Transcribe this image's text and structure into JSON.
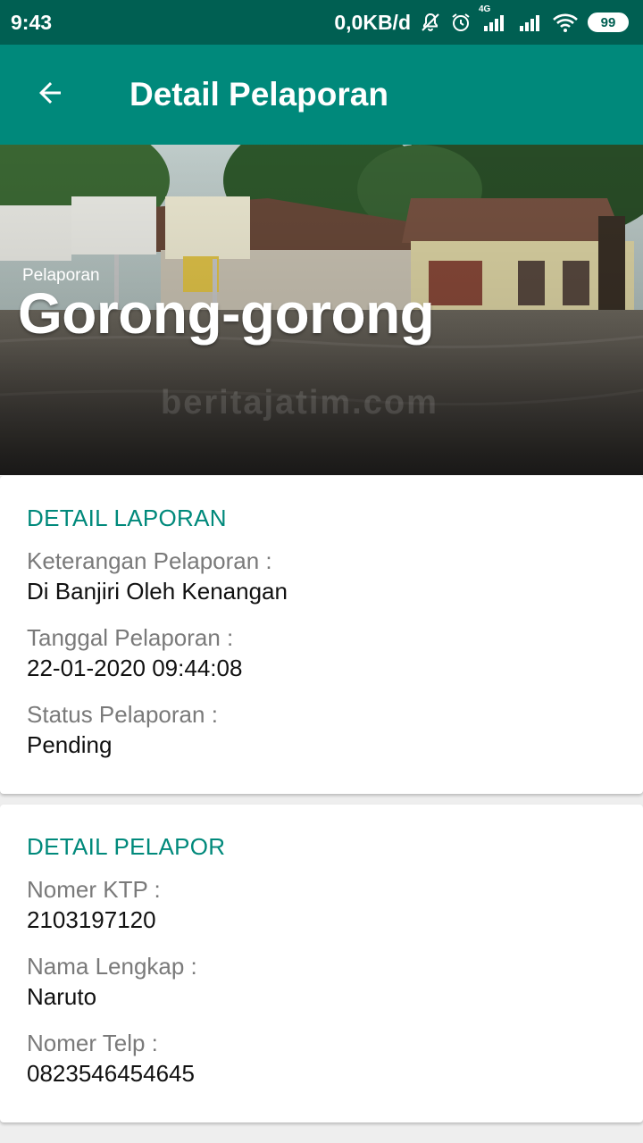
{
  "status_bar": {
    "time": "9:43",
    "data_speed": "0,0KB/d",
    "network_type": "4G",
    "battery": "99",
    "icons": [
      "mute-bell-icon",
      "alarm-icon",
      "signal-icon",
      "signal-icon",
      "wifi-icon",
      "battery-icon"
    ]
  },
  "app_bar": {
    "title": "Detail Pelaporan",
    "back_icon": "arrow-back-icon",
    "color": "#00897b"
  },
  "hero": {
    "overline": "Pelaporan",
    "title": "Gorong-gorong",
    "watermark": "beritajatim.com"
  },
  "report_details": {
    "section_title": "DETAIL LAPORAN",
    "fields": [
      {
        "label": "Keterangan Pelaporan :",
        "value": "Di Banjiri Oleh Kenangan"
      },
      {
        "label": "Tanggal Pelaporan :",
        "value": "22-01-2020 09:44:08"
      },
      {
        "label": "Status Pelaporan :",
        "value": "Pending"
      }
    ]
  },
  "reporter_details": {
    "section_title": "DETAIL PELAPOR",
    "fields": [
      {
        "label": "Nomer KTP :",
        "value": "2103197120"
      },
      {
        "label": "Nama Lengkap :",
        "value": "Naruto"
      },
      {
        "label": "Nomer Telp :",
        "value": "0823546454645"
      }
    ]
  },
  "colors": {
    "status_bar": "#005f52",
    "accent": "#00897b",
    "label": "#7a7a7a",
    "value": "#111111"
  }
}
